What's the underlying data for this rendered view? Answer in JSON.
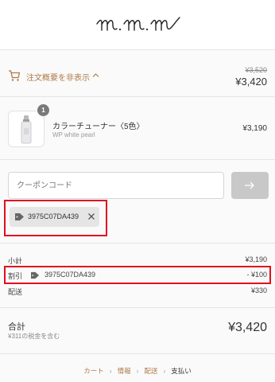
{
  "brand": {
    "logo_text": "m.m.m"
  },
  "summary_toggle": {
    "label": "注文概要を非表示",
    "original_total": "¥3,520",
    "current_total": "¥3,420"
  },
  "product": {
    "name": "カラーチューナー〈5色〉",
    "variant": "WP white pearl",
    "quantity": "1",
    "price": "¥3,190"
  },
  "coupon": {
    "placeholder": "クーポンコード",
    "value": ""
  },
  "applied_tag": {
    "code": "3975C07DA439"
  },
  "totals": {
    "subtotal_label": "小計",
    "subtotal_value": "¥3,190",
    "discount_label": "割引",
    "discount_code": "3975C07DA439",
    "discount_value": "- ¥100",
    "shipping_label": "配送",
    "shipping_value": "¥330",
    "total_label": "合計",
    "tax_note": "¥311の税金を含む",
    "total_value": "¥3,420"
  },
  "breadcrumb": {
    "cart": "カート",
    "info": "情報",
    "shipping": "配送",
    "payment": "支払い"
  },
  "colors": {
    "accent": "#b07a4a",
    "highlight": "#e0101e",
    "chip_bg": "#e5e5e5"
  }
}
